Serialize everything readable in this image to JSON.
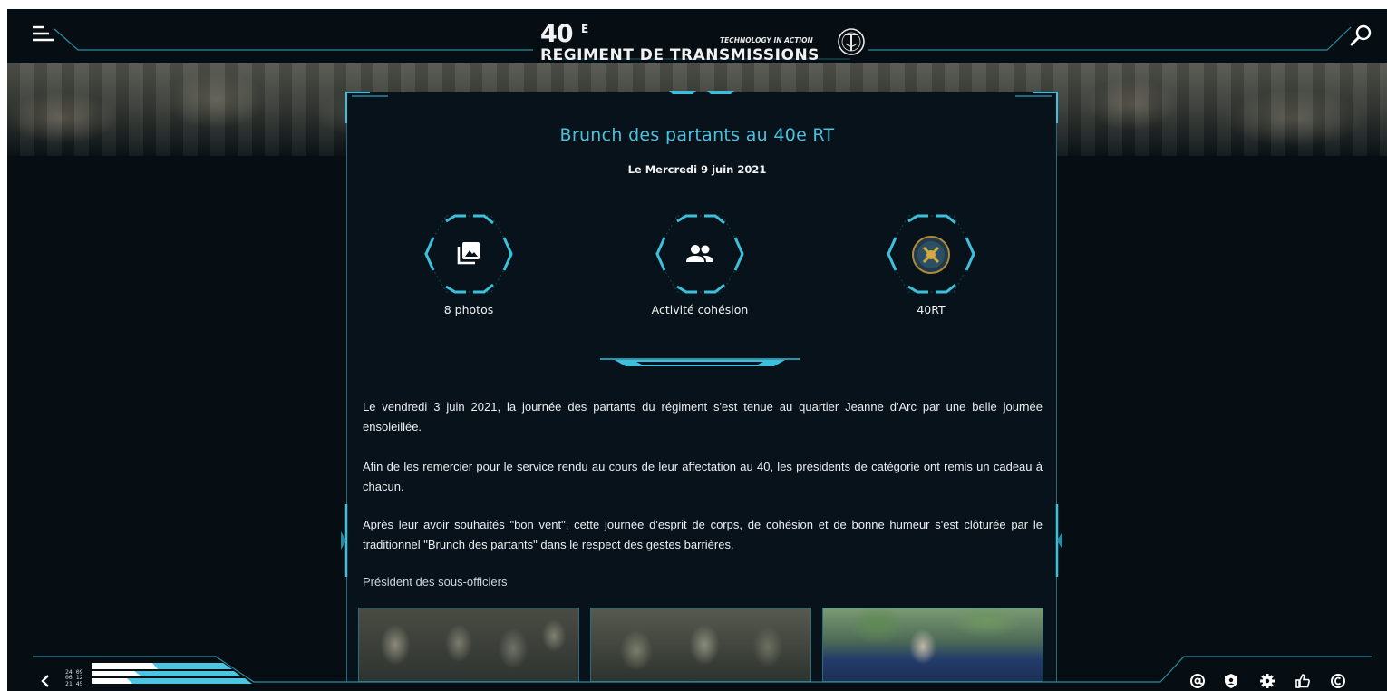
{
  "header": {
    "logo_number": "40",
    "logo_superscript": "E",
    "logo_name": "REGIMENT DE TRANSMISSIONS",
    "logo_tagline": "TECHNOLOGY IN ACTION"
  },
  "article": {
    "title": "Brunch des partants au 40e RT",
    "date": "Le Mercredi 9 juin 2021",
    "meta": [
      {
        "label": "8 photos",
        "icon": "photo-library-icon"
      },
      {
        "label": "Activité cohésion",
        "icon": "group-icon"
      },
      {
        "label": "40RT",
        "icon": "regiment-badge-icon"
      }
    ],
    "paragraphs": [
      "Le vendredi 3 juin 2021, la journée des partants du régiment s'est tenue au quartier Jeanne d'Arc par une belle journée ensoleillée.",
      "Afin de les remercier pour le service rendu au cours de leur affectation au 40, les présidents de catégorie ont remis un cadeau à chacun.",
      "Après leur avoir souhaités \"bon vent\", cette journée d'esprit de corps, de cohésion et de bonne humeur s'est clôturée par le traditionnel \"Brunch des partants\" dans le respect des gestes barrières.",
      "Président des sous-officiers"
    ]
  },
  "footer": {
    "clock_lines": [
      "24 09",
      "06 12",
      "21 45"
    ],
    "icons": [
      "at-icon",
      "shield-icon",
      "gear-icon",
      "thumbs-up-icon",
      "copyright-icon"
    ]
  },
  "colors": {
    "accent": "#48c3df",
    "background": "#060e13",
    "panel": "#07121a",
    "line": "#1c6c7d"
  }
}
